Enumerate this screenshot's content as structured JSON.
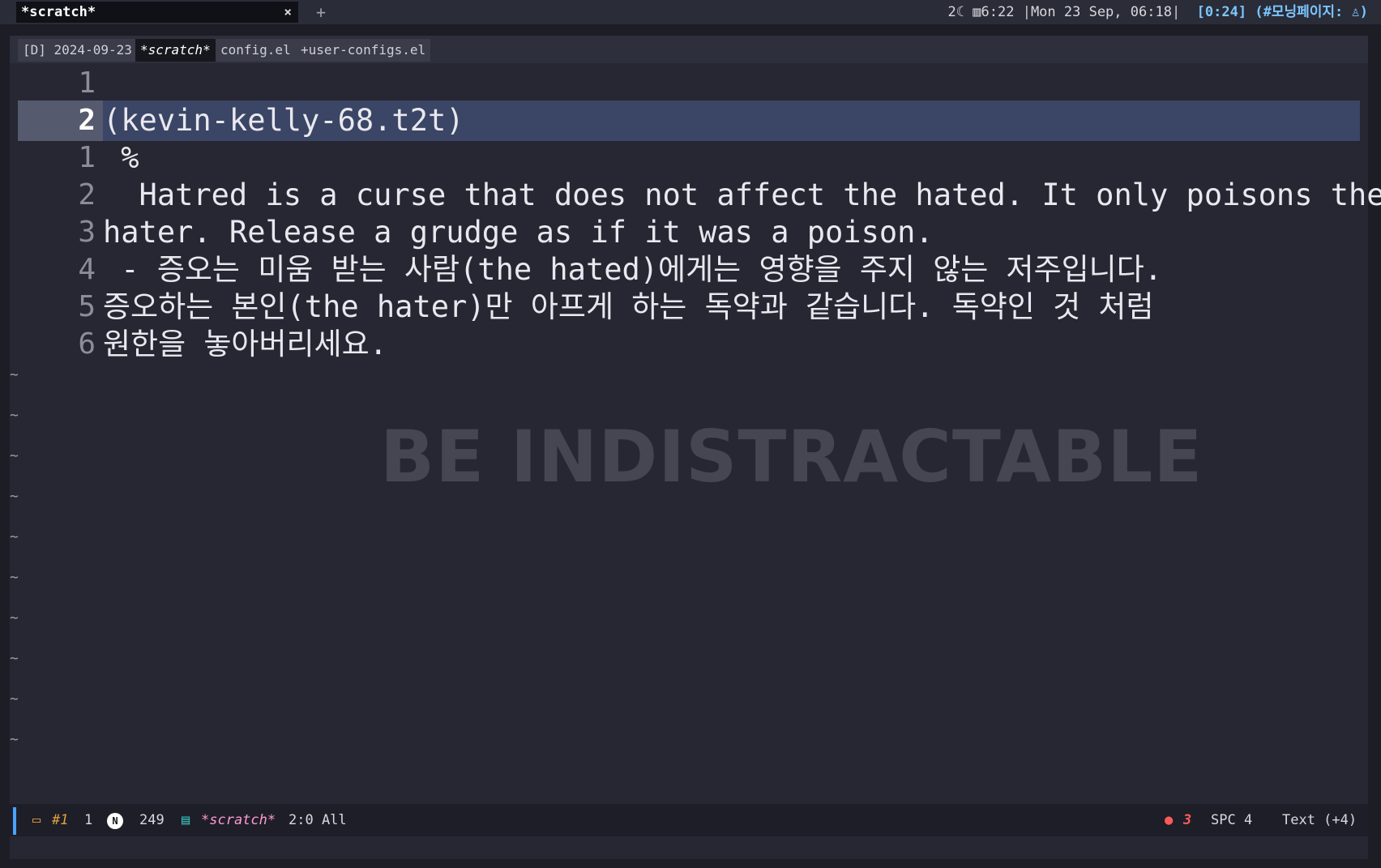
{
  "topbar": {
    "window_tab": "*scratch*",
    "close_glyph": "×",
    "new_tab_glyph": "+",
    "status": {
      "workspace_count": "2",
      "moon_icon": "☾",
      "battery_icon": "▥",
      "battery_time": "6:22",
      "date_time": "Mon 23 Sep, 06:18",
      "clock_session": "[0:24]",
      "channel": "(#모닝페이지:",
      "meditation_icon": "♙",
      "channel_close": ")"
    }
  },
  "buffer_tabs": [
    "[D] 2024-09-23",
    "*scratch*",
    "config.el",
    "+user-configs.el"
  ],
  "editor": {
    "lines": [
      {
        "num": "1",
        "text": ""
      },
      {
        "num": "2",
        "text": "(kevin-kelly-68.t2t)",
        "current": true
      },
      {
        "num": "1",
        "text": " %"
      },
      {
        "num": "2",
        "text": "  Hatred is a curse that does not affect the hated. It only poisons the"
      },
      {
        "num": "3",
        "text": "hater. Release a grudge as if it was a poison."
      },
      {
        "num": "4",
        "text": " - 증오는 미움 받는 사람(the hated)에게는 영향을 주지 않는 저주입니다."
      },
      {
        "num": "5",
        "text": "증오하는 본인(the hater)만 아프게 하는 독약과 같습니다. 독약인 것 처럼"
      },
      {
        "num": "6",
        "text": "원한을 놓아버리세요."
      }
    ],
    "tilde": "~",
    "watermark": "BE INDISTRACTABLE"
  },
  "modeline": {
    "workspace_icon": "▭",
    "workspace": "#1",
    "window_num": "1",
    "mode_badge": "N",
    "char_count": "249",
    "file_icon": "▤",
    "buffer_name": "*scratch*",
    "position": "2:0 All",
    "github_icon": "●",
    "github_count": "3",
    "indent": "SPC 4",
    "major_mode": "Text (+4)"
  },
  "colors": {
    "background": "#262733",
    "current_line": "#3b4565",
    "accent": "#7cc6ff",
    "buffer_name": "#ff9ad1",
    "workspace": "#e0a040",
    "github": "#ff5a5a"
  }
}
